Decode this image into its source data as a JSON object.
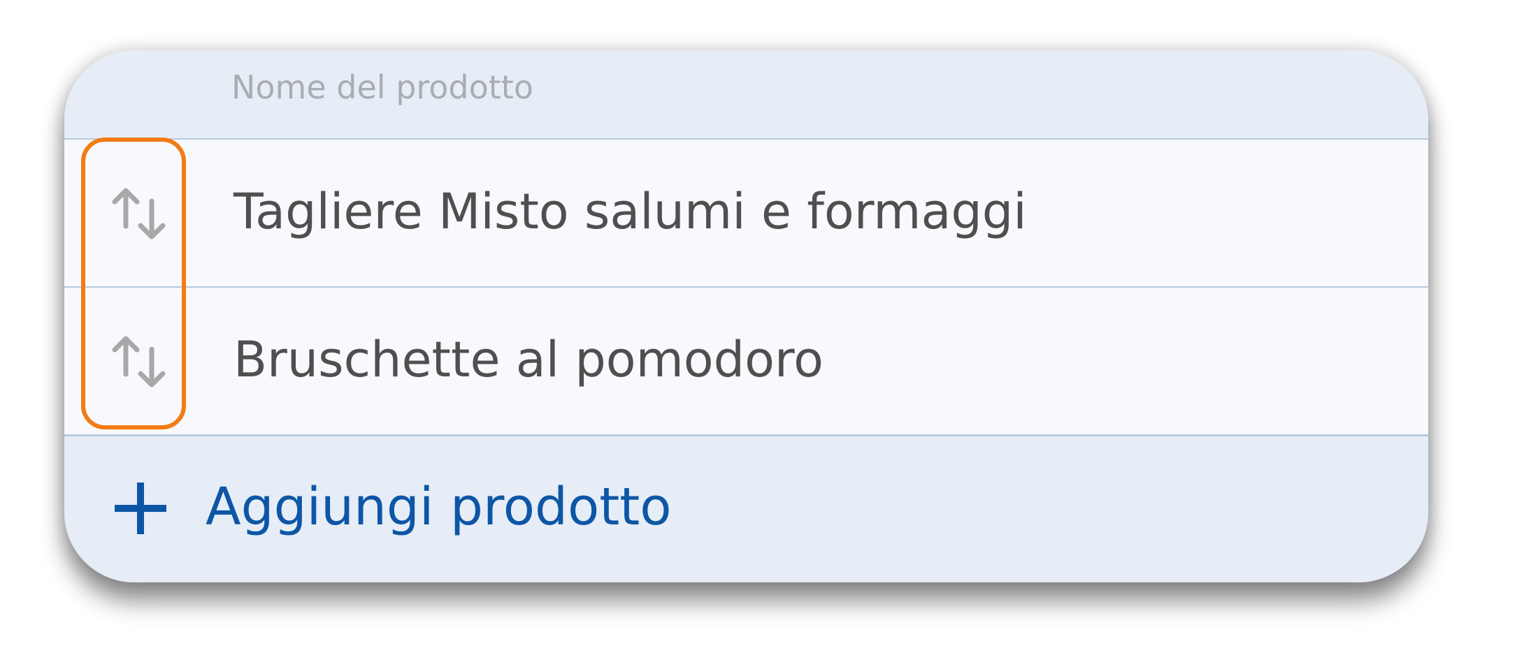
{
  "table": {
    "column_header": "Nome del prodotto",
    "rows": [
      {
        "label": "Tagliere Misto salumi e formaggi",
        "drag_icon": "sort-arrows-icon"
      },
      {
        "label": "Bruschette al pomodoro",
        "drag_icon": "sort-arrows-icon"
      }
    ],
    "add_button": {
      "label": "Aggiungi prodotto",
      "icon": "plus-icon"
    }
  },
  "colors": {
    "card_background": "#e6edf6",
    "row_background": "#f7f9fd",
    "divider": "#b7cadf",
    "accent": "#0d56a6",
    "highlight_outline": "#f27b13",
    "text": "#4f4f4f",
    "muted_text": "#a9adb3"
  }
}
